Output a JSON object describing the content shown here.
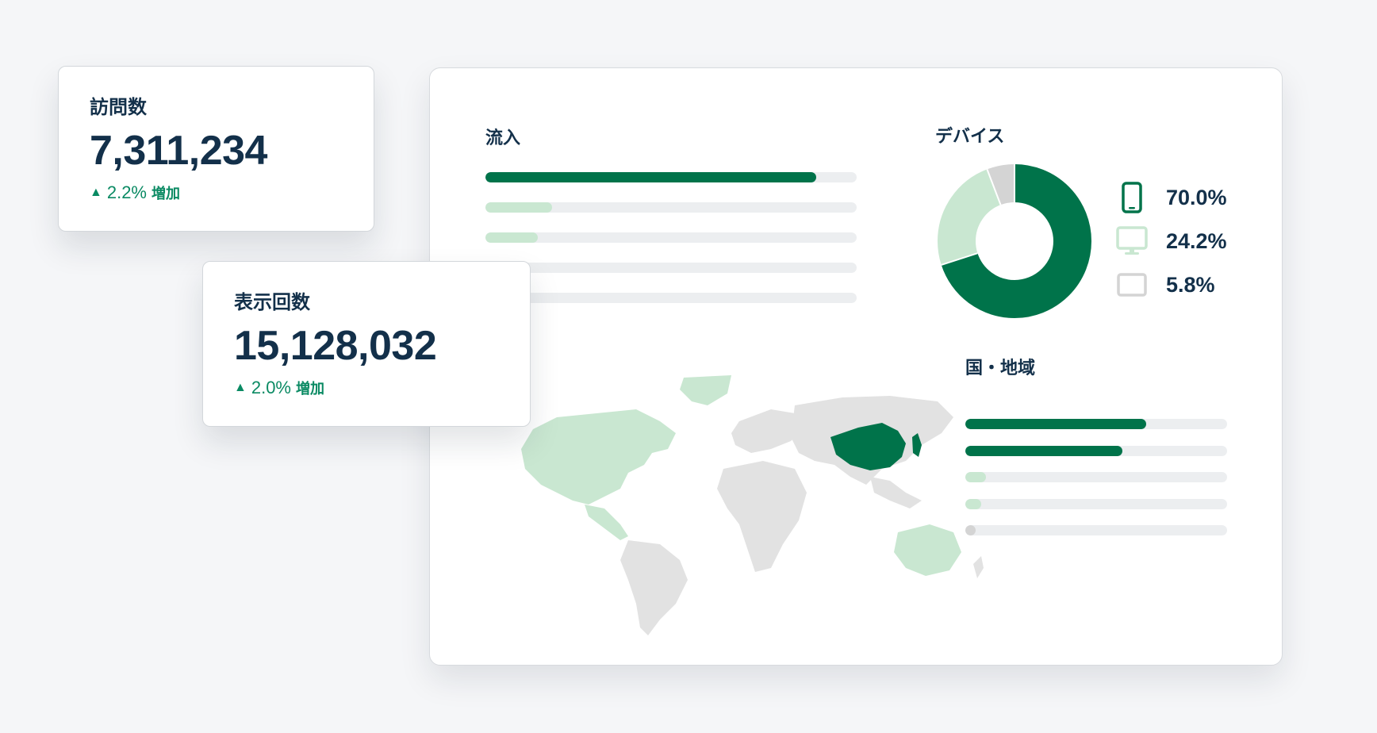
{
  "colors": {
    "primary": "#00734a",
    "light": "#c9e7d1",
    "grey": "#d4d4d4",
    "track": "#eceef0",
    "map_land": "#e2e2e2",
    "trend": "#0a8a63"
  },
  "cards": {
    "visits": {
      "title": "訪問数",
      "value": "7,311,234",
      "trend_icon": "▲",
      "trend_percent": "2.2%",
      "trend_label": "増加"
    },
    "impressions": {
      "title": "表示回数",
      "value": "15,128,032",
      "trend_icon": "▲",
      "trend_percent": "2.0%",
      "trend_label": "増加"
    }
  },
  "inflow": {
    "title": "流入",
    "bars": [
      {
        "fraction": 0.89,
        "color": "primary"
      },
      {
        "fraction": 0.18,
        "color": "light"
      },
      {
        "fraction": 0.14,
        "color": "light"
      },
      {
        "fraction": 0.0,
        "color": "light"
      },
      {
        "fraction": 0.0,
        "color": "light"
      }
    ]
  },
  "device": {
    "title": "デバイス",
    "items": [
      {
        "icon": "smartphone-icon",
        "value": "70.0%",
        "share": 70.0,
        "color": "primary"
      },
      {
        "icon": "desktop-icon",
        "value": "24.2%",
        "share": 24.2,
        "color": "light"
      },
      {
        "icon": "tablet-icon",
        "value": "5.8%",
        "share": 5.8,
        "color": "grey"
      }
    ]
  },
  "region": {
    "title": "国・地域",
    "bars": [
      {
        "fraction": 0.69,
        "color": "primary"
      },
      {
        "fraction": 0.6,
        "color": "primary"
      },
      {
        "fraction": 0.08,
        "color": "light"
      },
      {
        "fraction": 0.06,
        "color": "light"
      },
      {
        "fraction": 0.04,
        "color": "grey"
      }
    ]
  }
}
